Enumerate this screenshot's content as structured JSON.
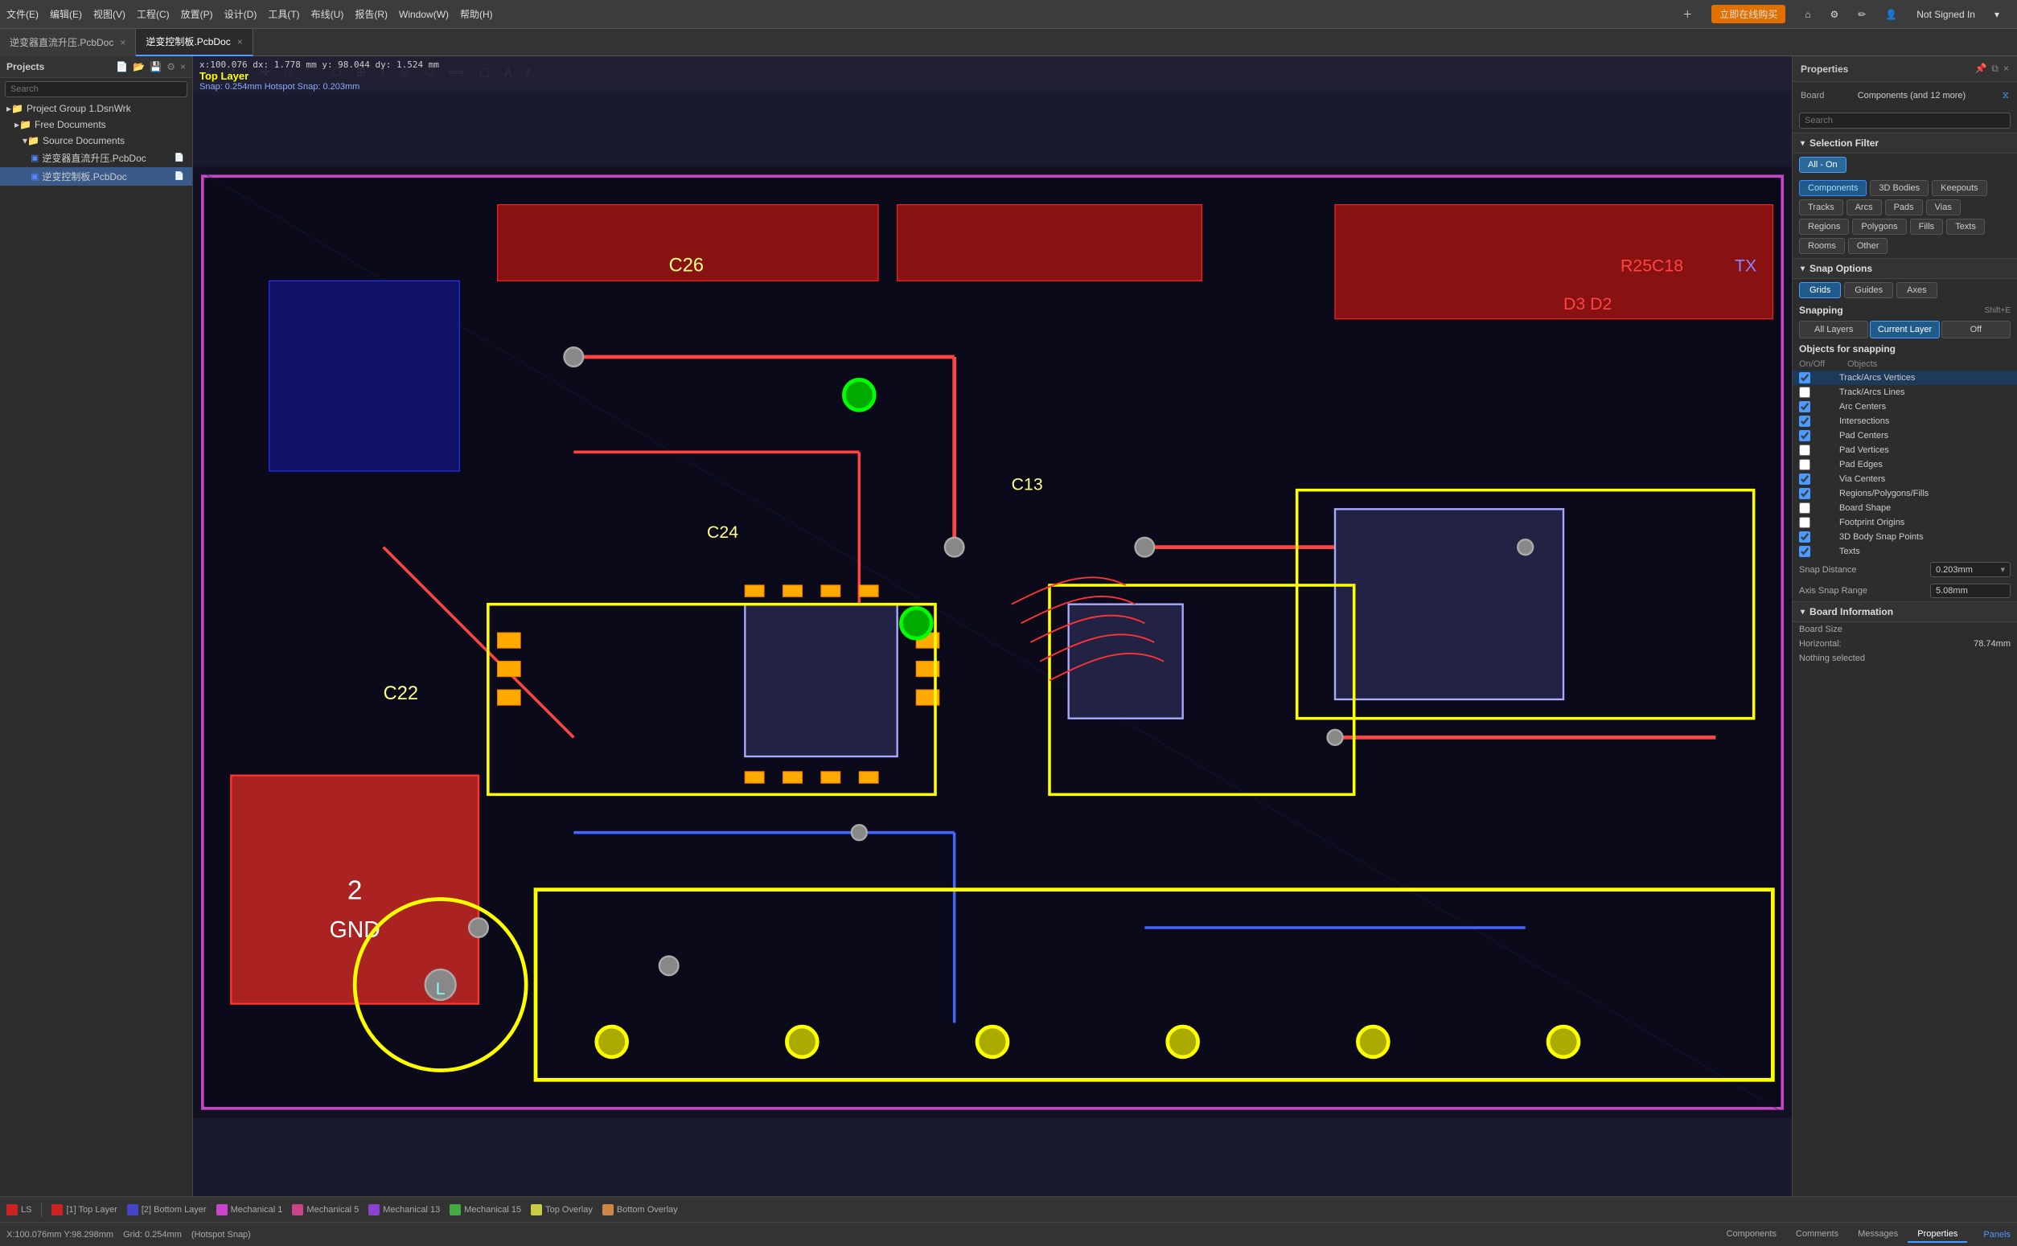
{
  "menubar": {
    "items": [
      "文件(E)",
      "编辑(E)",
      "视图(V)",
      "工程(C)",
      "放置(P)",
      "设计(D)",
      "工具(T)",
      "布线(U)",
      "报告(R)",
      "Window(W)",
      "帮助(H)"
    ],
    "btn_online": "立即在线购买",
    "user": "Not Signed In"
  },
  "tabs": [
    {
      "label": "逆变器直流升压.PcbDoc",
      "active": false
    },
    {
      "label": "逆变控制板.PcbDoc",
      "active": true
    }
  ],
  "canvas": {
    "coords": "x:100.076  dx: 1.778 mm\ny: 98.044  dy: 1.524 mm",
    "layer": "Top Layer",
    "snap": "Snap: 0.254mm  Hotspot Snap: 0.203mm"
  },
  "projects": {
    "title": "Projects",
    "search_placeholder": "Search",
    "tree": [
      {
        "label": "Project Group 1.DsnWrk",
        "level": 0,
        "type": "group"
      },
      {
        "label": "Free Documents",
        "level": 1,
        "type": "folder"
      },
      {
        "label": "Source Documents",
        "level": 2,
        "type": "folder"
      },
      {
        "label": "逆变器直流升压.PcbDoc",
        "level": 3,
        "type": "file"
      },
      {
        "label": "逆变控制板.PcbDoc",
        "level": 3,
        "type": "file",
        "selected": true
      }
    ]
  },
  "properties": {
    "title": "Properties",
    "board_label": "Board",
    "components_label": "Components (and 12 more)",
    "search_placeholder": "Search",
    "selection_filter_title": "Selection Filter",
    "all_on_label": "All - On",
    "filter_buttons": [
      {
        "label": "Components",
        "type": "blue"
      },
      {
        "label": "3D Bodies",
        "type": "normal"
      },
      {
        "label": "Keepouts",
        "type": "normal"
      },
      {
        "label": "Tracks",
        "type": "normal"
      },
      {
        "label": "Arcs",
        "type": "normal"
      },
      {
        "label": "Pads",
        "type": "normal"
      },
      {
        "label": "Vias",
        "type": "normal"
      },
      {
        "label": "Regions",
        "type": "normal"
      },
      {
        "label": "Polygons",
        "type": "normal"
      },
      {
        "label": "Fills",
        "type": "normal"
      },
      {
        "label": "Texts",
        "type": "normal"
      },
      {
        "label": "Rooms",
        "type": "normal"
      },
      {
        "label": "Other",
        "type": "normal"
      }
    ],
    "snap_options_title": "Snap Options",
    "snap_tabs": [
      "Grids",
      "Guides",
      "Axes"
    ],
    "snapping_label": "Snapping",
    "snapping_shortcut": "Shift+E",
    "snap_modes": [
      "All Layers",
      "Current Layer",
      "Off"
    ],
    "active_snap_mode": "Current Layer",
    "objects_for_snapping": "Objects for snapping",
    "snap_table_headers": [
      "On/Off",
      "Objects"
    ],
    "snap_objects": [
      {
        "name": "Track/Arcs Vertices",
        "checked": true,
        "highlighted": true
      },
      {
        "name": "Track/Arcs Lines",
        "checked": false
      },
      {
        "name": "Arc Centers",
        "checked": true
      },
      {
        "name": "Intersections",
        "checked": true
      },
      {
        "name": "Pad Centers",
        "checked": true
      },
      {
        "name": "Pad Vertices",
        "checked": false
      },
      {
        "name": "Pad Edges",
        "checked": false
      },
      {
        "name": "Via Centers",
        "checked": true
      },
      {
        "name": "Regions/Polygons/Fills",
        "checked": true
      },
      {
        "name": "Board Shape",
        "checked": false
      },
      {
        "name": "Footprint Origins",
        "checked": false
      },
      {
        "name": "3D Body Snap Points",
        "checked": true
      },
      {
        "name": "Texts",
        "checked": true
      }
    ],
    "snap_distance_label": "Snap Distance",
    "snap_distance_value": "0.203mm",
    "axis_snap_range_label": "Axis Snap Range",
    "axis_snap_range_value": "5.08mm",
    "board_info_title": "Board Information",
    "board_size_title": "Board Size",
    "horizontal_label": "Horizontal:",
    "horizontal_value": "78.74mm",
    "nothing_selected": "Nothing selected"
  },
  "statusbar": {
    "coords": "X:100.076mm Y:98.298mm",
    "grid": "Grid: 0.254mm",
    "hotspot": "(Hotspot Snap)",
    "layers": [
      {
        "color": "#cc2222",
        "label": "LS"
      },
      {
        "color": "#cc2222",
        "label": "[1] Top Layer"
      },
      {
        "color": "#4444cc",
        "label": "[2] Bottom Layer"
      },
      {
        "color": "#cc44cc",
        "label": "Mechanical 1"
      },
      {
        "color": "#cc4488",
        "label": "Mechanical 5"
      },
      {
        "color": "#8844cc",
        "label": "Mechanical 13"
      },
      {
        "color": "#44aa44",
        "label": "Mechanical 15"
      },
      {
        "color": "#cccc44",
        "label": "Top Overlay"
      },
      {
        "color": "#cc8844",
        "label": "Bottom Overlay"
      }
    ]
  },
  "bottom_tabs": [
    "Components",
    "Comments",
    "Messages",
    "Properties"
  ],
  "active_bottom_tab": "Properties",
  "right_bottom": "Panels"
}
